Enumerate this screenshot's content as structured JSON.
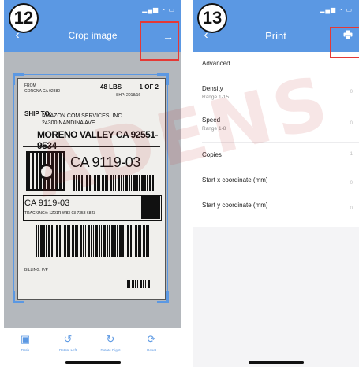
{
  "left_screen": {
    "step_number": "12",
    "title": "Crop image",
    "back_icon": "chevron-left-icon",
    "action_icon": "arrow-right-icon",
    "label": {
      "sender_line1": "FROM",
      "sender_line2": "CORONA CA 92880",
      "weight": "48 LBS",
      "piece_count": "1 OF 2",
      "ship_date": "SHP: 2018/16",
      "ship_to": "SHIP TO:",
      "recipient_line1": "AMAZON.COM SERVICES, INC.",
      "recipient_line2": "24300 NANDINA AVE",
      "recipient_city": "MORENO VALLEY CA 92551-9534",
      "routing_code_big": "CA 9119-03",
      "routing_code_small": "CA 9119-03",
      "tracking": "TRACKING#: 1Z91R W83 03 7358 6843",
      "billing": "BILLING: P/P"
    },
    "toolbar": [
      {
        "icon": "image-icon",
        "label": "Ratio"
      },
      {
        "icon": "rotate-left-icon",
        "label": "Rotate Left"
      },
      {
        "icon": "rotate-right-icon",
        "label": "Rotate Right"
      },
      {
        "icon": "reset-icon",
        "label": "Reset"
      }
    ]
  },
  "right_screen": {
    "step_number": "13",
    "title": "Print",
    "back_icon": "chevron-left-icon",
    "action_icon": "printer-icon",
    "section": "Advanced",
    "rows": [
      {
        "title": "Density",
        "subtitle": "Range 1-15",
        "value": "0"
      },
      {
        "title": "Speed",
        "subtitle": "Range 1-8",
        "value": "0"
      },
      {
        "title": "Copies",
        "subtitle": "",
        "value": "1"
      },
      {
        "title": "Start x coordinate (mm)",
        "subtitle": "",
        "value": "0"
      },
      {
        "title": "Start y coordinate (mm)",
        "subtitle": "",
        "value": "0"
      }
    ]
  },
  "watermark": "ADENS",
  "colors": {
    "accent": "#5b98e3",
    "highlight": "#e53935"
  }
}
